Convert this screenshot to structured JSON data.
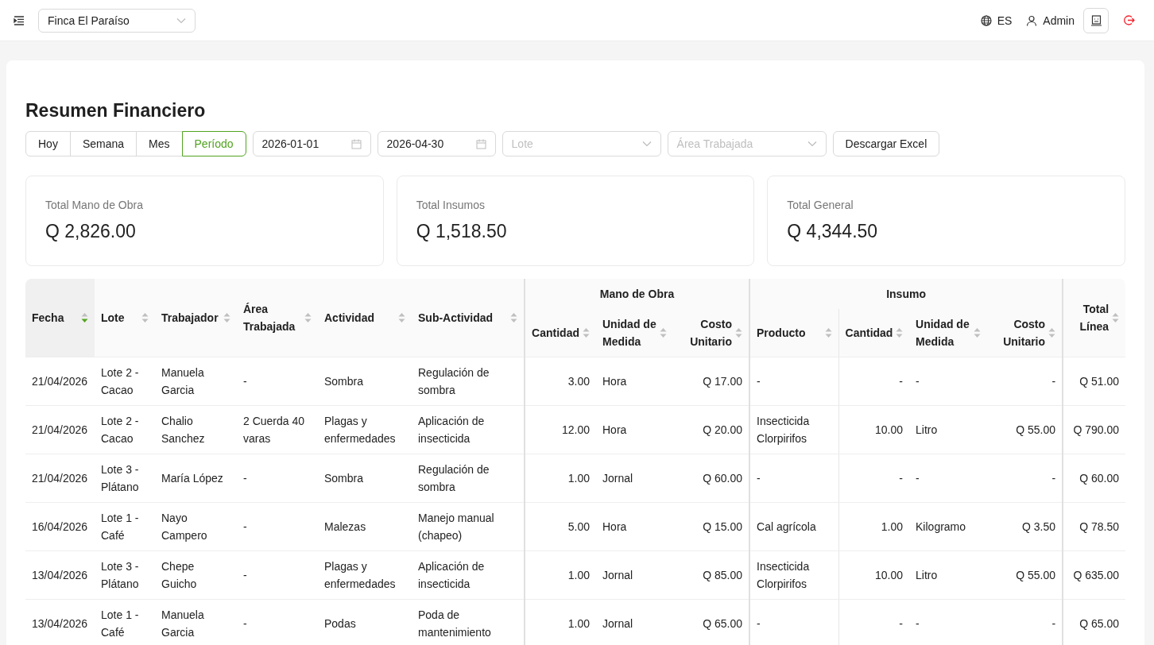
{
  "topbar": {
    "farm_select": "Finca El Paraíso",
    "language": "ES",
    "user": "Admin"
  },
  "page": {
    "title": "Resumen Financiero"
  },
  "periods": [
    {
      "label": "Hoy",
      "selected": false
    },
    {
      "label": "Semana",
      "selected": false
    },
    {
      "label": "Mes",
      "selected": false
    },
    {
      "label": "Período",
      "selected": true
    }
  ],
  "filters": {
    "date_from": "2026-01-01",
    "date_to": "2026-04-30",
    "lote": {
      "placeholder": "Lote"
    },
    "area": {
      "placeholder": "Área Trabajada"
    },
    "export_button": "Descargar Excel"
  },
  "summary": [
    {
      "label": "Total Mano de Obra",
      "value": "Q 2,826.00"
    },
    {
      "label": "Total Insumos",
      "value": "Q 1,518.50"
    },
    {
      "label": "Total General",
      "value": "Q 4,344.50"
    }
  ],
  "table": {
    "columns": [
      {
        "kind": "single",
        "label": "Fecha",
        "sorted": true
      },
      {
        "kind": "single",
        "label": "Lote",
        "sorted": false
      },
      {
        "kind": "single",
        "label": "Trabajador",
        "sorted": false
      },
      {
        "kind": "single",
        "label": "Área Trabajada",
        "sorted": false
      },
      {
        "kind": "single",
        "label": "Actividad",
        "sorted": false
      },
      {
        "kind": "single",
        "label": "Sub-Actividad",
        "sorted": false
      },
      {
        "kind": "group",
        "label": "Mano de Obra",
        "colspan": 3,
        "children": [
          {
            "label": "Cantidad",
            "sorted": false
          },
          {
            "label": "Unidad de Medida",
            "sorted": false
          },
          {
            "label": "Costo Unitario",
            "sorted": false
          }
        ]
      },
      {
        "kind": "group",
        "label": "Insumo",
        "colspan": 4,
        "children": [
          {
            "label": "Producto",
            "sorted": false
          },
          {
            "label": "Cantidad",
            "sorted": false
          },
          {
            "label": "Unidad de Medida",
            "sorted": false
          },
          {
            "label": "Costo Unitario",
            "sorted": false
          }
        ]
      },
      {
        "kind": "single",
        "label": "Total Línea",
        "sorted": false
      }
    ],
    "rows": [
      [
        "21/04/2026",
        "Lote 2 - Cacao",
        "Manuela Garcia",
        "-",
        "Sombra",
        "Regulación de sombra",
        "3.00",
        "Hora",
        "Q 17.00",
        "-",
        "-",
        "-",
        "-",
        "Q 51.00"
      ],
      [
        "21/04/2026",
        "Lote 2 - Cacao",
        "Chalio Sanchez",
        "2 Cuerda 40 varas",
        "Plagas y enfermedades",
        "Aplicación de insecticida",
        "12.00",
        "Hora",
        "Q 20.00",
        "Insecticida Clorpirifos",
        "10.00",
        "Litro",
        "Q 55.00",
        "Q 790.00"
      ],
      [
        "21/04/2026",
        "Lote 3 - Plátano",
        "María López",
        "-",
        "Sombra",
        "Regulación de sombra",
        "1.00",
        "Jornal",
        "Q 60.00",
        "-",
        "-",
        "-",
        "-",
        "Q 60.00"
      ],
      [
        "16/04/2026",
        "Lote 1 - Café",
        "Nayo Campero",
        "-",
        "Malezas",
        "Manejo manual (chapeo)",
        "5.00",
        "Hora",
        "Q 15.00",
        "Cal agrícola",
        "1.00",
        "Kilogramo",
        "Q 3.50",
        "Q 78.50"
      ],
      [
        "13/04/2026",
        "Lote 3 - Plátano",
        "Chepe Guicho",
        "-",
        "Plagas y enfermedades",
        "Aplicación de insecticida",
        "1.00",
        "Jornal",
        "Q 85.00",
        "Insecticida Clorpirifos",
        "10.00",
        "Litro",
        "Q 55.00",
        "Q 635.00"
      ],
      [
        "13/04/2026",
        "Lote 1 - Café",
        "Manuela Garcia",
        "-",
        "Podas",
        "Poda de mantenimiento",
        "1.00",
        "Jornal",
        "Q 65.00",
        "-",
        "-",
        "-",
        "-",
        "Q 65.00"
      ]
    ]
  }
}
